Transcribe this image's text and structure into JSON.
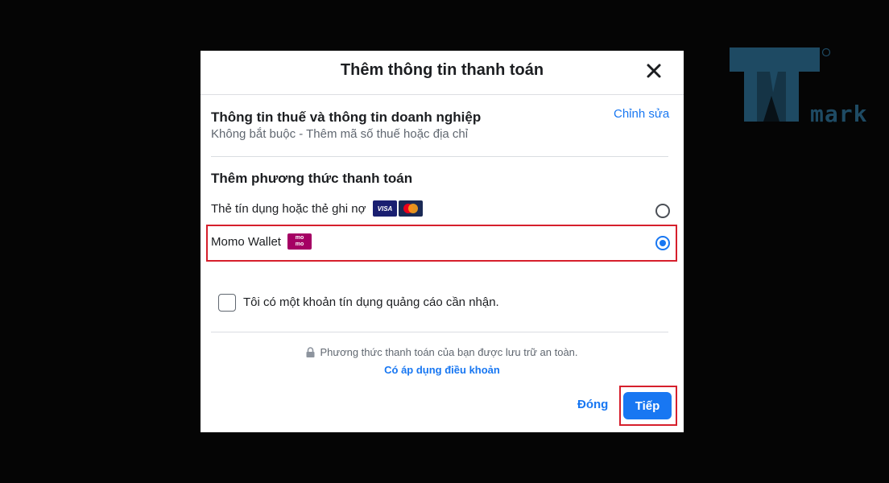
{
  "dialog": {
    "title": "Thêm thông tin thanh toán",
    "tax": {
      "title": "Thông tin thuế và thông tin doanh nghiệp",
      "subtitle": "Không bắt buộc - Thêm mã số thuế hoặc địa chỉ",
      "edit_label": "Chỉnh sửa"
    },
    "payment": {
      "title": "Thêm phương thức thanh toán",
      "options": [
        {
          "label": "Thẻ tín dụng hoặc thẻ ghi nợ",
          "selected": false,
          "icons": [
            "visa-icon",
            "mastercard-icon"
          ]
        },
        {
          "label": "Momo Wallet",
          "selected": true,
          "icons": [
            "momo-icon"
          ]
        }
      ]
    },
    "credit_checkbox": {
      "label": "Tôi có một khoản tín dụng quảng cáo cần nhận.",
      "checked": false
    },
    "secure_note": "Phương thức thanh toán của bạn được lưu trữ an toàn.",
    "terms_link": "Có áp dụng điều khoản",
    "buttons": {
      "close": "Đóng",
      "next": "Tiếp"
    }
  },
  "badges": {
    "visa": "VISA",
    "momo_top": "mo",
    "momo_bottom": "mo"
  },
  "colors": {
    "accent": "#1877f2",
    "highlight": "#d61f2c",
    "momo": "#a50064"
  },
  "watermark": {
    "text": "mark"
  }
}
